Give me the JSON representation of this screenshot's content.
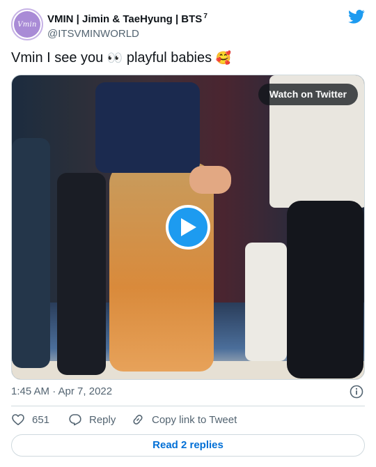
{
  "colors": {
    "twitter_blue": "#1d9bf0",
    "text": "#0f1419",
    "muted": "#536471",
    "link": "#006fd6",
    "border": "#cfd9de"
  },
  "author": {
    "display_name": "VMIN | Jimin & TaeHyung | BTS",
    "superscript": "7",
    "handle": "@ITSVMINWORLD",
    "avatar_text": "Vmin",
    "avatar_icon": "avatar-logo"
  },
  "tweet": {
    "text_part1": "Vmin I see you ",
    "emoji_eyes": "👀",
    "text_part2": " playful babies ",
    "emoji_smile": "🥰"
  },
  "media": {
    "watch_label": "Watch on Twitter",
    "play_icon": "play-icon"
  },
  "meta": {
    "timestamp": "1:45 AM · Apr 7, 2022",
    "info_icon": "info-icon"
  },
  "actions": {
    "like_count": "651",
    "reply_label": "Reply",
    "copy_label": "Copy link to Tweet"
  },
  "footer": {
    "read_replies": "Read 2 replies"
  }
}
